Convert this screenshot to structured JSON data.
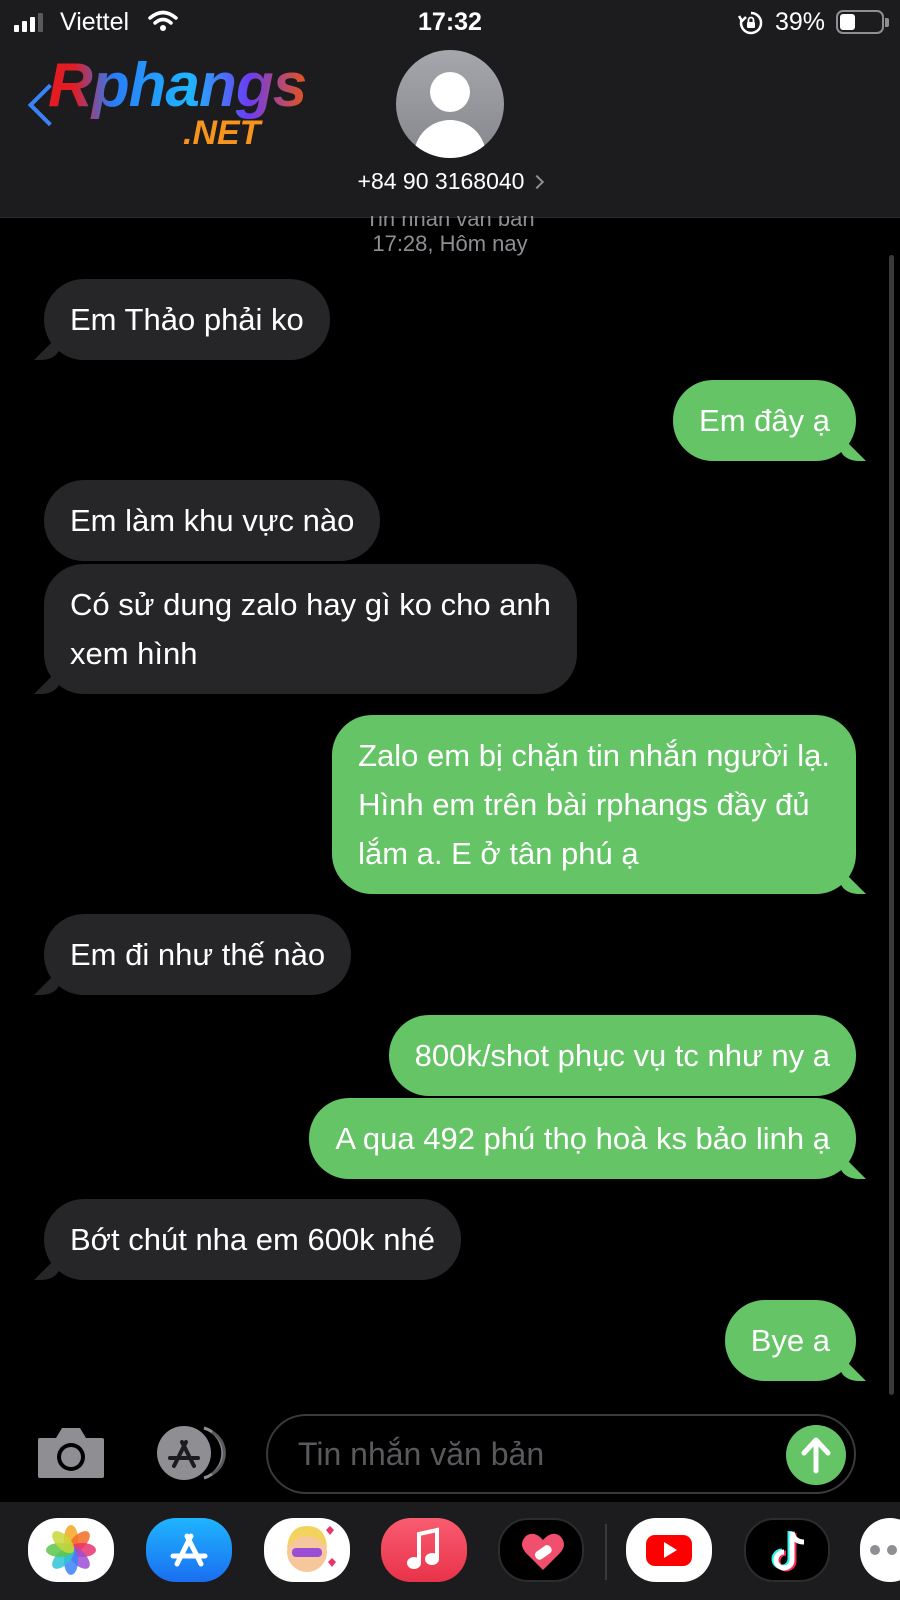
{
  "status_bar": {
    "carrier": "Viettel",
    "time": "17:32",
    "battery_percent": "39%",
    "battery_level": 0.39,
    "signal_bars": 3
  },
  "header": {
    "logo_main": "Rphangs",
    "logo_sub": ".NET",
    "contact": "+84 90 3168040"
  },
  "thread": {
    "label": "Tin nhắn văn bản",
    "timestamp": "17:28, Hôm nay"
  },
  "messages": [
    {
      "from": "them",
      "text": "Em Thảo phải ko"
    },
    {
      "from": "me",
      "text": "Em đây ạ"
    },
    {
      "from": "them",
      "text": "Em làm khu vực nào"
    },
    {
      "from": "them",
      "text": "Có sử dung zalo hay gì ko cho anh\nxem hình"
    },
    {
      "from": "me",
      "text": "Zalo em bị chặn tin nhắn người lạ.\nHình em trên bài rphangs đầy đủ\nlắm a. E ở tân phú ạ"
    },
    {
      "from": "them",
      "text": "Em đi như thế nào"
    },
    {
      "from": "me",
      "text": "800k/shot phục vụ tc như ny a"
    },
    {
      "from": "me",
      "text": "A qua 492 phú thọ hoà ks bảo linh ạ"
    },
    {
      "from": "them",
      "text": "Bớt chút nha em 600k nhé"
    },
    {
      "from": "me",
      "text": "Bye a"
    }
  ],
  "input": {
    "placeholder": "Tin nhắn văn bản"
  },
  "dock": {
    "apps": [
      "photos-icon",
      "app-store-icon",
      "memoji-icon",
      "music-icon",
      "health-icon",
      "youtube-icon",
      "tiktok-icon",
      "more-icon"
    ]
  },
  "colors": {
    "incoming_bubble": "#262628",
    "outgoing_bubble": "#65c466",
    "accent": "#3a82f7"
  }
}
